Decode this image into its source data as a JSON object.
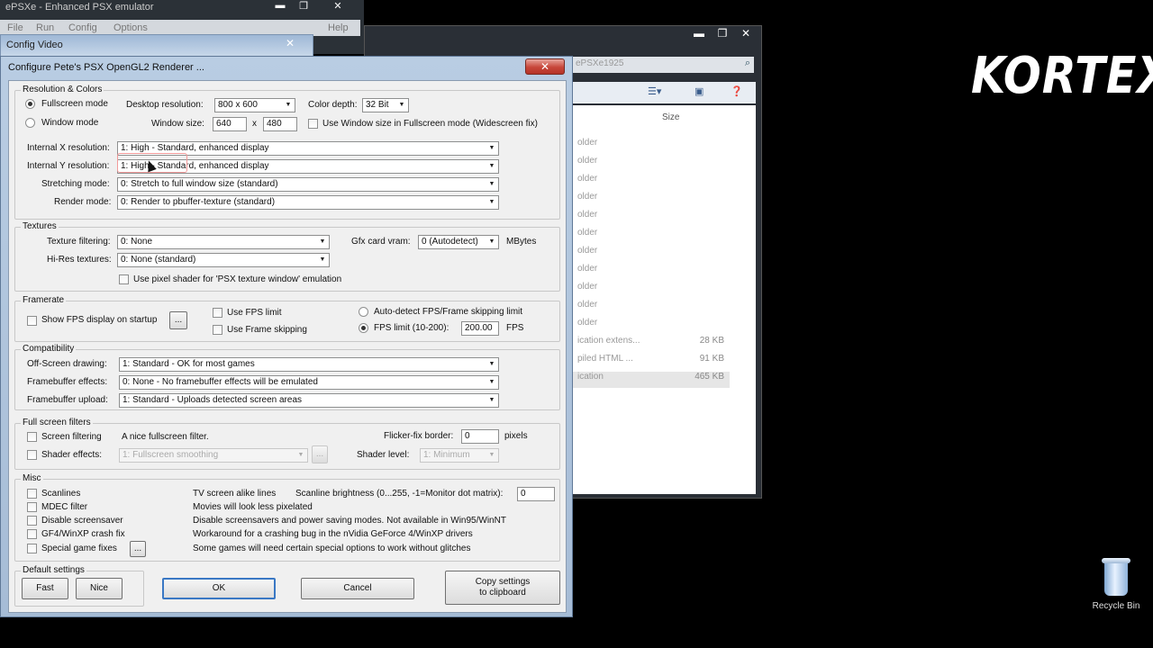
{
  "desktop": {
    "logo": "KORTEX",
    "recycle_bin": "Recycle Bin"
  },
  "explorer": {
    "address": "ePSXe1925",
    "column_size": "Size",
    "folder_rows": [
      "older",
      "older",
      "older",
      "older",
      "older",
      "older",
      "older",
      "older",
      "older",
      "older",
      "older"
    ],
    "file_rows": [
      {
        "name": "ication extens...",
        "size": "28 KB"
      },
      {
        "name": "piled HTML ...",
        "size": "91 KB"
      },
      {
        "name": "ication",
        "size": "465 KB"
      }
    ]
  },
  "epsxe": {
    "title": "ePSXe - Enhanced PSX emulator",
    "menu": [
      "File",
      "Run",
      "Config",
      "Options",
      "Help"
    ]
  },
  "config_video": {
    "title": "Config Video"
  },
  "dialog": {
    "title": "Configure Pete's PSX OpenGL2 Renderer ...",
    "resolution": {
      "group": "Resolution & Colors",
      "fullscreen_mode": "Fullscreen mode",
      "window_mode": "Window mode",
      "desktop_resolution_label": "Desktop resolution:",
      "desktop_resolution": "800 x 600",
      "color_depth_label": "Color depth:",
      "color_depth": "32 Bit",
      "window_size_label": "Window size:",
      "window_w": "640",
      "window_x": "x",
      "window_h": "480",
      "use_window_size": "Use Window size in Fullscreen mode (Widescreen fix)",
      "internal_x_label": "Internal X resolution:",
      "internal_x": "1: High - Standard, enhanced display",
      "internal_y_label": "Internal Y resolution:",
      "internal_y": "1: High - Standard, enhanced display",
      "stretching_label": "Stretching mode:",
      "stretching": "0: Stretch to full window size (standard)",
      "render_label": "Render mode:",
      "render": "0: Render to pbuffer-texture (standard)"
    },
    "textures": {
      "group": "Textures",
      "filtering_label": "Texture filtering:",
      "filtering": "0: None",
      "hires_label": "Hi-Res textures:",
      "hires": "0: None (standard)",
      "gfx_vram_label": "Gfx card vram:",
      "gfx_vram": "0 (Autodetect)",
      "mbytes": "MBytes",
      "pixel_shader": "Use pixel shader for 'PSX texture window' emulation"
    },
    "framerate": {
      "group": "Framerate",
      "show_fps": "Show FPS display on startup",
      "ellipsis": "...",
      "use_fps_limit": "Use FPS limit",
      "use_frame_skipping": "Use Frame skipping",
      "auto_detect": "Auto-detect FPS/Frame skipping limit",
      "fps_limit_label": "FPS limit (10-200):",
      "fps_limit": "200.00",
      "fps": "FPS"
    },
    "compatibility": {
      "group": "Compatibility",
      "offscreen_label": "Off-Screen drawing:",
      "offscreen": "1: Standard - OK for most games",
      "fb_effects_label": "Framebuffer effects:",
      "fb_effects": "0: None - No framebuffer effects will be emulated",
      "fb_upload_label": "Framebuffer upload:",
      "fb_upload": "1: Standard - Uploads detected screen areas"
    },
    "filters": {
      "group": "Full screen filters",
      "screen_filtering": "Screen filtering",
      "screen_filtering_desc": "A nice fullscreen filter.",
      "flicker_label": "Flicker-fix border:",
      "flicker": "0",
      "pixels": "pixels",
      "shader_effects": "Shader effects:",
      "shader_value": "1: Fullscreen smoothing",
      "shader_level_label": "Shader level:",
      "shader_level": "1: Minimum"
    },
    "misc": {
      "group": "Misc",
      "scanlines": "Scanlines",
      "scanlines_desc": "TV screen alike lines",
      "scanline_brightness": "Scanline brightness (0...255, -1=Monitor dot matrix):",
      "scanline_value": "0",
      "mdec": "MDEC filter",
      "mdec_desc": "Movies will look less pixelated",
      "disable_ss": "Disable screensaver",
      "disable_ss_desc": "Disable screensavers and power saving modes. Not available in Win95/WinNT",
      "gf4": "GF4/WinXP crash fix",
      "gf4_desc": "Workaround for a crashing bug in the nVidia GeForce 4/WinXP drivers",
      "special": "Special game fixes",
      "special_desc": "Some games will need certain special options to work without glitches"
    },
    "defaults": {
      "group": "Default settings",
      "fast": "Fast",
      "nice": "Nice"
    },
    "buttons": {
      "ok": "OK",
      "cancel": "Cancel",
      "copy_line1": "Copy settings",
      "copy_line2": "to clipboard"
    }
  }
}
